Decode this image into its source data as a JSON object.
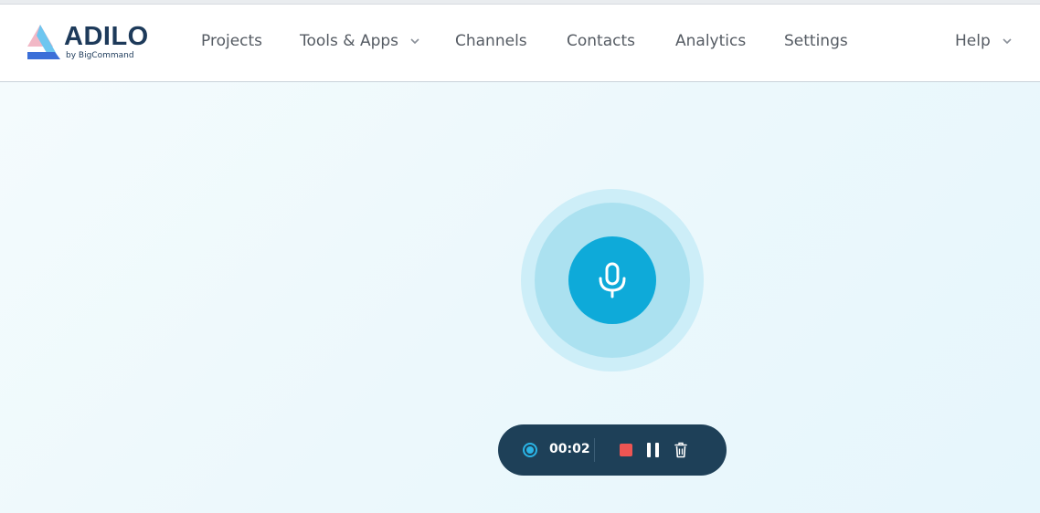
{
  "brand": {
    "name": "ADILO",
    "tagline": "by BigCommand",
    "colors": {
      "navy": "#1d3a5a",
      "blue": "#3b6fd8",
      "pink": "#f2b8c6",
      "sky": "#6ec6f0"
    }
  },
  "nav": {
    "items": [
      {
        "label": "Projects",
        "has_dropdown": false
      },
      {
        "label": "Tools & Apps",
        "has_dropdown": true
      },
      {
        "label": "Channels",
        "has_dropdown": false
      },
      {
        "label": "Contacts",
        "has_dropdown": false
      },
      {
        "label": "Analytics",
        "has_dropdown": false
      },
      {
        "label": "Settings",
        "has_dropdown": false
      }
    ],
    "help": {
      "label": "Help",
      "has_dropdown": true
    }
  },
  "recorder": {
    "mic_icon": "microphone-icon",
    "status": "recording",
    "elapsed": "00:02",
    "controls": {
      "stop_icon": "stop-icon",
      "pause_icon": "pause-icon",
      "delete_icon": "trash-icon"
    },
    "colors": {
      "mic": "#0eaad9",
      "bar": "#1e4058",
      "stop": "#ee5553",
      "dot": "#2ab4e6"
    }
  }
}
